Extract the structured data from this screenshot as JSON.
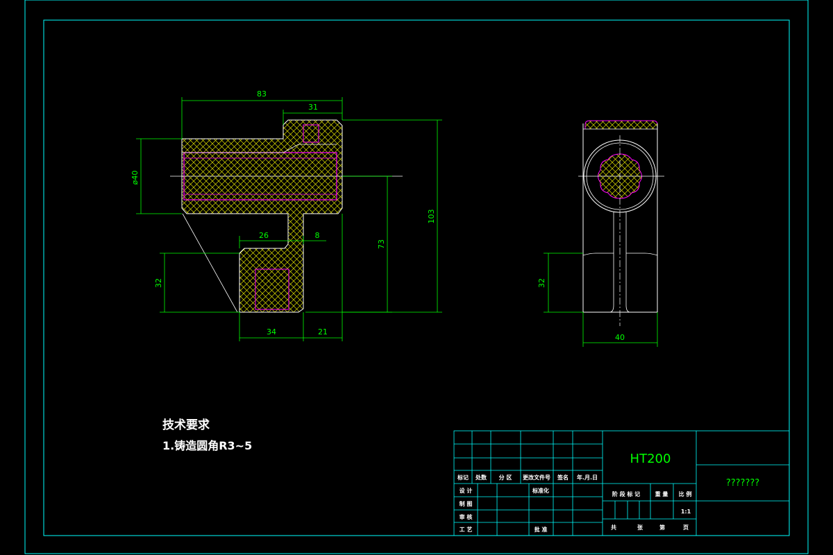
{
  "drawing": {
    "front_view": {
      "dims": {
        "d83": "83",
        "d31": "31",
        "dia40": "ø40",
        "d26": "26",
        "d8": "8",
        "d73": "73",
        "d103": "103",
        "d32": "32",
        "d34": "34",
        "d21": "21"
      }
    },
    "side_view": {
      "dims": {
        "d32": "32",
        "d40": "40"
      }
    }
  },
  "notes": {
    "title": "技术要求",
    "item1": "1.铸造圆角R3~5"
  },
  "title_block": {
    "material": "HT200",
    "drawing_name": "???????",
    "scale": "1:1",
    "labels": {
      "mark": "标记",
      "count": "处数",
      "zone": "分 区",
      "change_doc": "更改文件号",
      "signature": "签名",
      "date": "年.月.日",
      "design": "设 计",
      "standardize": "标准化",
      "draw": "制 图",
      "review": "审 核",
      "process": "工 艺",
      "approve": "批 准",
      "stage_mark": "阶 段 标 记",
      "weight": "重 量",
      "ratio": "比 例",
      "total": "共",
      "sheets": "张",
      "no": "第",
      "page": "页"
    }
  },
  "colors": {
    "background": "#000000",
    "outline": "#ffffff",
    "frame": "#00ffff",
    "dimension": "#00ff00",
    "hatch_yellow": "#e0e000",
    "hatch_magenta": "#ff00ff"
  }
}
